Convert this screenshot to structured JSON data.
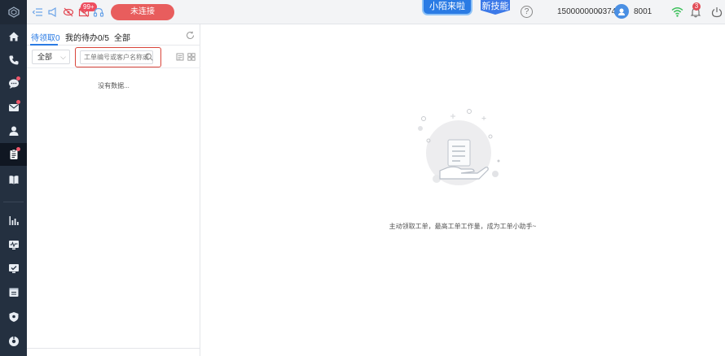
{
  "topbar": {
    "message_badge": "99+",
    "connect_button": "未连接",
    "promo_a": "小陌来啦",
    "promo_b": "新技能",
    "help": "?",
    "phone": "1500000000374",
    "agent_id": "8001",
    "notification_count": "3",
    "icons": [
      "collapse-icon",
      "broadcast-icon",
      "eye-off-icon",
      "mail-off-icon",
      "headset-icon",
      "help-icon",
      "wifi-icon",
      "bell-icon",
      "power-icon"
    ]
  },
  "sidebar": {
    "items": [
      "home-icon",
      "phone-icon",
      "chat-icon",
      "mail-icon",
      "user-icon",
      "clipboard-icon",
      "book-icon",
      "bar-chart-icon",
      "monitor-icon",
      "screen-check-icon",
      "calendar-icon",
      "shield-icon",
      "settings-icon"
    ]
  },
  "panel": {
    "tabs": [
      {
        "label": "待领取0"
      },
      {
        "label": "我的待办0/5"
      },
      {
        "label": "全部"
      }
    ],
    "filter_value": "全部",
    "search_placeholder": "工单编号或客户名称或",
    "empty_text": "没有数据..."
  },
  "main": {
    "empty_message": "主动领取工单，最高工单工作量，成为工单小助手~"
  },
  "colors": {
    "sidebar_bg": "#243040",
    "accent_blue": "#2a7be4",
    "alert_red": "#e85d5d",
    "highlight_border": "#d9443a"
  }
}
